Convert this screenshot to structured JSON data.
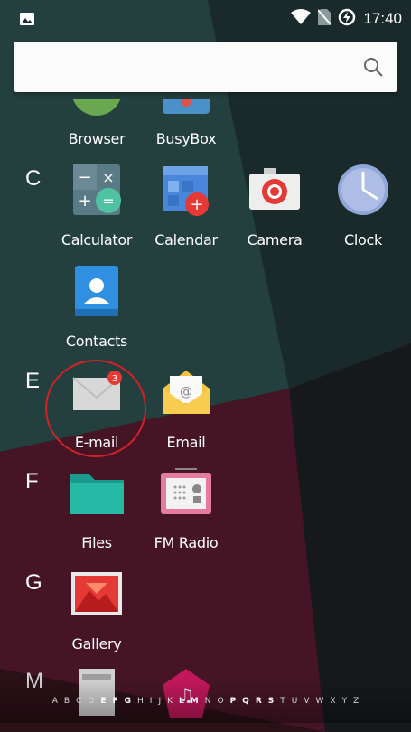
{
  "status_bar": {
    "time": "17:40",
    "icons": [
      "gallery-icon",
      "wifi-icon",
      "no-sim-icon",
      "battery-charging-icon"
    ]
  },
  "search": {
    "placeholder": "",
    "icon": "search-icon"
  },
  "sections": [
    {
      "letter": "",
      "apps": [
        {
          "label": "Browser",
          "icon": "browser-icon"
        },
        {
          "label": "BusyBox",
          "icon": "busybox-icon"
        }
      ]
    },
    {
      "letter": "C",
      "apps": [
        {
          "label": "Calculator",
          "icon": "calculator-icon"
        },
        {
          "label": "Calendar",
          "icon": "calendar-icon"
        },
        {
          "label": "Camera",
          "icon": "camera-icon"
        },
        {
          "label": "Clock",
          "icon": "clock-icon"
        },
        {
          "label": "Contacts",
          "icon": "contacts-icon"
        }
      ]
    },
    {
      "letter": "E",
      "apps": [
        {
          "label": "E-mail",
          "icon": "email-gray-icon",
          "badge": "3"
        },
        {
          "label": "Email",
          "icon": "email-yellow-icon"
        }
      ]
    },
    {
      "letter": "F",
      "apps": [
        {
          "label": "Files",
          "icon": "folder-icon"
        },
        {
          "label": "FM Radio",
          "icon": "radio-icon"
        }
      ]
    },
    {
      "letter": "G",
      "apps": [
        {
          "label": "Gallery",
          "icon": "gallery-app-icon"
        }
      ]
    },
    {
      "letter": "M",
      "apps": [
        {
          "label": "",
          "icon": "app-icon-partial"
        },
        {
          "label": "",
          "icon": "music-icon"
        }
      ]
    }
  ],
  "alphabet_index": [
    "A",
    "B",
    "C",
    "D",
    "E",
    "F",
    "G",
    "H",
    "I",
    "J",
    "K",
    "L",
    "M",
    "N",
    "O",
    "P",
    "Q",
    "R",
    "S",
    "T",
    "U",
    "V",
    "W",
    "X",
    "Y",
    "Z"
  ],
  "colors": {
    "background_teal": "#1c2b2c",
    "background_maroon": "#4a1020",
    "annotation_red": "#d3202a",
    "badge_red": "#e53935"
  }
}
